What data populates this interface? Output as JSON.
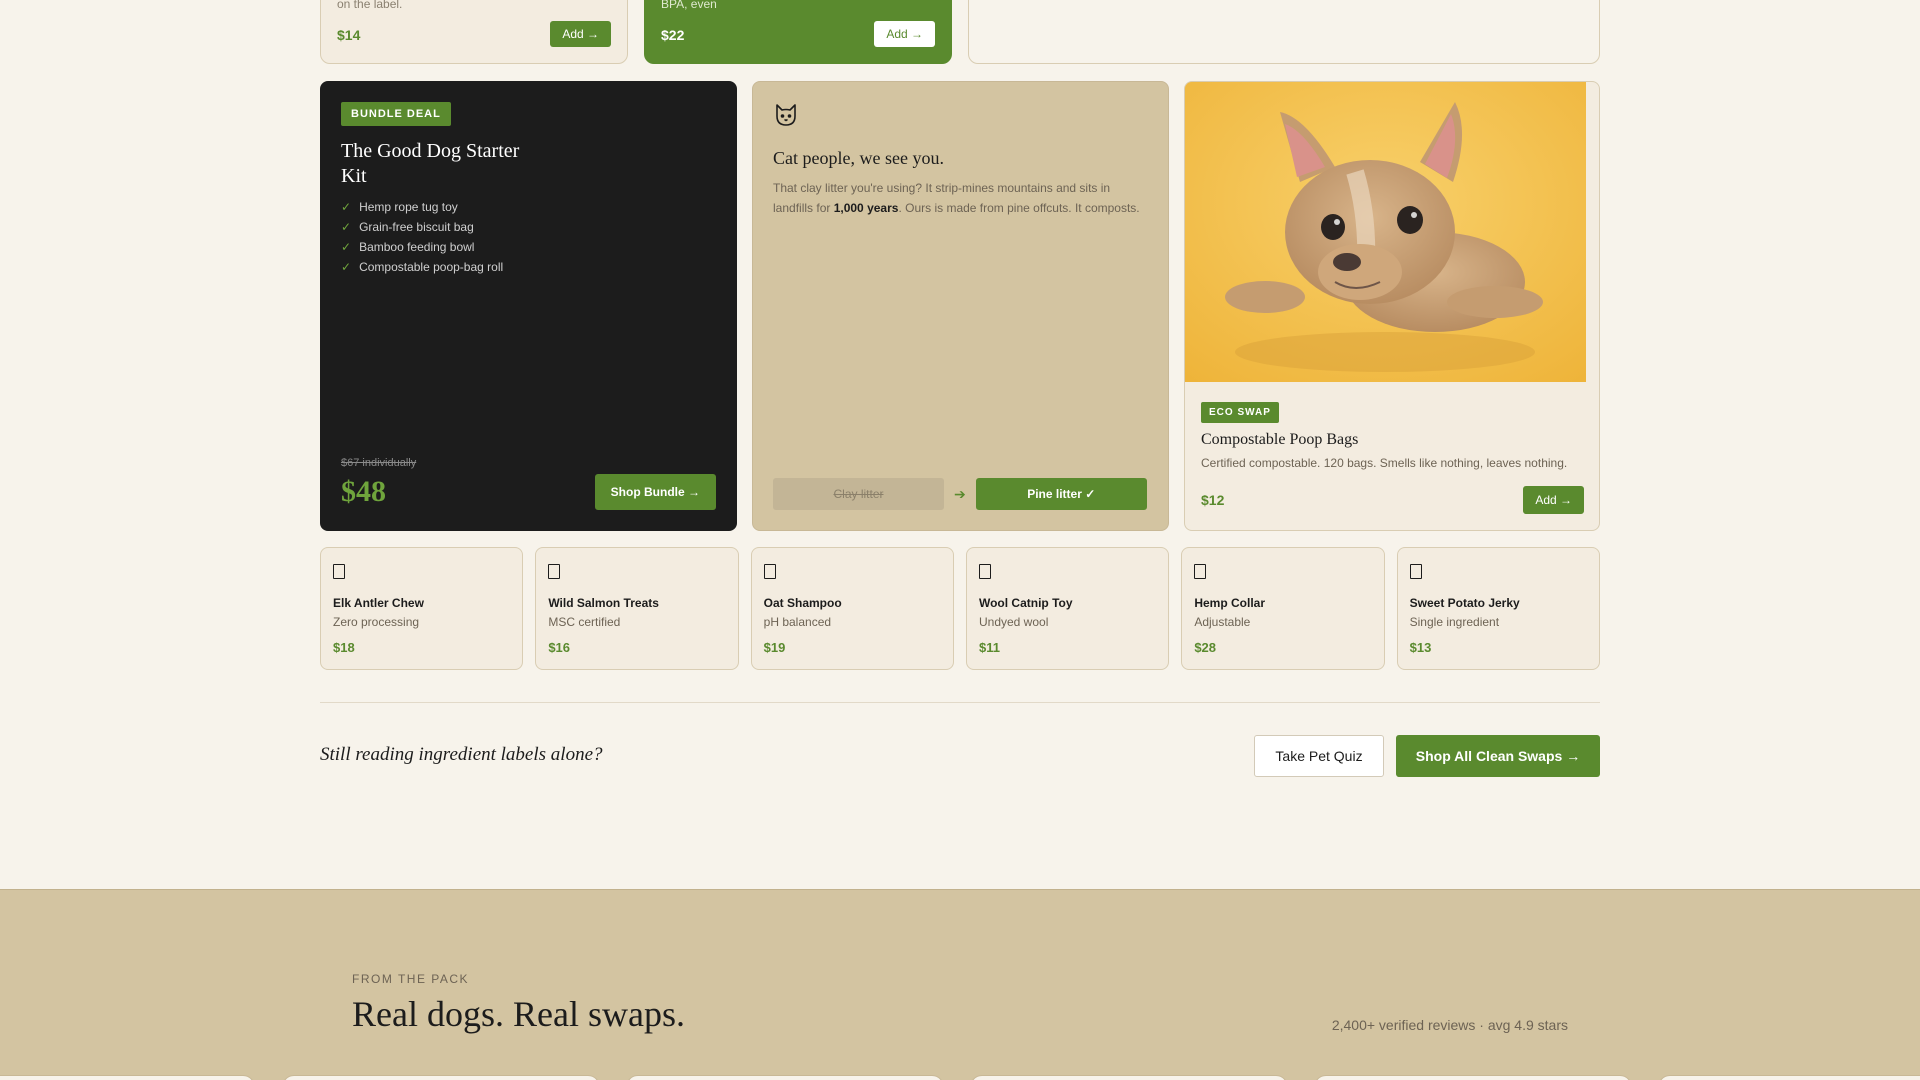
{
  "top_cards": [
    {
      "cut_text": "on the label.",
      "price": "$14",
      "button": "Add →"
    },
    {
      "cut_text": "BPA, even",
      "price": "$22",
      "button": "Add →"
    }
  ],
  "bundle": {
    "badge": "BUNDLE DEAL",
    "title": "The Good Dog Starter Kit",
    "items": [
      "Hemp rope tug toy",
      "Grain-free biscuit bag",
      "Bamboo feeding bowl",
      "Compostable poop-bag roll"
    ],
    "check_icon": "✓",
    "was_price": "$67 individually",
    "price": "$48",
    "button": "Shop Bundle →"
  },
  "cat": {
    "icon": "cat-face-icon",
    "title": "Cat people, we see you.",
    "body_before": "That clay litter you're using? It strip-mines mountains and sits in landfills for ",
    "body_bold": "1,000 years",
    "body_after": ". Ours is made from pine offcuts. It composts.",
    "from_label": "Clay litter",
    "arrow": "➔",
    "to_label": "Pine litter ✓"
  },
  "eco": {
    "badge": "ECO SWAP",
    "title": "Compostable Poop Bags",
    "description": "Certified compostable. 120 bags. Smells like nothing, leaves nothing.",
    "price": "$12",
    "button": "Add →"
  },
  "products": [
    {
      "name": "Elk Antler Chew",
      "sub": "Zero processing",
      "price": "$18"
    },
    {
      "name": "Wild Salmon Treats",
      "sub": "MSC certified",
      "price": "$16"
    },
    {
      "name": "Oat Shampoo",
      "sub": "pH balanced",
      "price": "$19"
    },
    {
      "name": "Wool Catnip Toy",
      "sub": "Undyed wool",
      "price": "$11"
    },
    {
      "name": "Hemp Collar",
      "sub": "Adjustable",
      "price": "$28"
    },
    {
      "name": "Sweet Potato Jerky",
      "sub": "Single ingredient",
      "price": "$13"
    }
  ],
  "cta": {
    "text": "Still reading ingredient labels alone?",
    "quiz_button": "Take Pet Quiz",
    "shop_button": "Shop All Clean Swaps →"
  },
  "reviews": {
    "eyebrow": "FROM THE PACK",
    "title": "Real dogs. Real swaps.",
    "stats": "2,400+ verified reviews · avg 4.9 stars"
  },
  "colors": {
    "accent": "#5a8a2e",
    "page_bg": "#f7f3eb",
    "tan": "#d3c4a1",
    "dark": "#1c1c1c"
  }
}
